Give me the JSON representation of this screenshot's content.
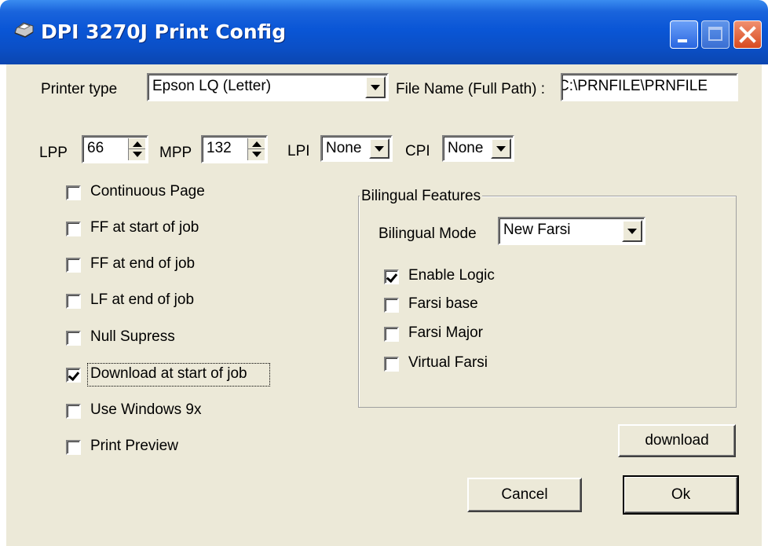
{
  "window": {
    "title": "DPI 3270J Print Config"
  },
  "printer": {
    "type_label": "Printer type",
    "type_value": "Epson LQ (Letter)",
    "file_label": "File Name (Full Path) :",
    "file_value": "C:\\PRNFILE\\PRNFILE"
  },
  "settings": {
    "lpp_label": "LPP",
    "lpp_value": "66",
    "mpp_label": "MPP",
    "mpp_value": "132",
    "lpi_label": "LPI",
    "lpi_value": "None",
    "cpi_label": "CPI",
    "cpi_value": "None"
  },
  "options": [
    {
      "label": "Continuous Page",
      "checked": false
    },
    {
      "label": "FF at start of job",
      "checked": false
    },
    {
      "label": "FF at end of job",
      "checked": false
    },
    {
      "label": "LF at end of job",
      "checked": false
    },
    {
      "label": "Null Supress",
      "checked": false
    },
    {
      "label": "Download at start of job",
      "checked": true
    },
    {
      "label": "Use Windows 9x",
      "checked": false
    },
    {
      "label": "Print Preview",
      "checked": false
    }
  ],
  "bilingual": {
    "group_title": "Bilingual Features",
    "mode_label": "Bilingual Mode",
    "mode_value": "New Farsi",
    "options": [
      {
        "label": "Enable Logic",
        "checked": true
      },
      {
        "label": "Farsi base",
        "checked": false
      },
      {
        "label": "Farsi Major",
        "checked": false
      },
      {
        "label": "Virtual Farsi",
        "checked": false
      }
    ]
  },
  "buttons": {
    "download": "download",
    "cancel": "Cancel",
    "ok": "Ok"
  }
}
